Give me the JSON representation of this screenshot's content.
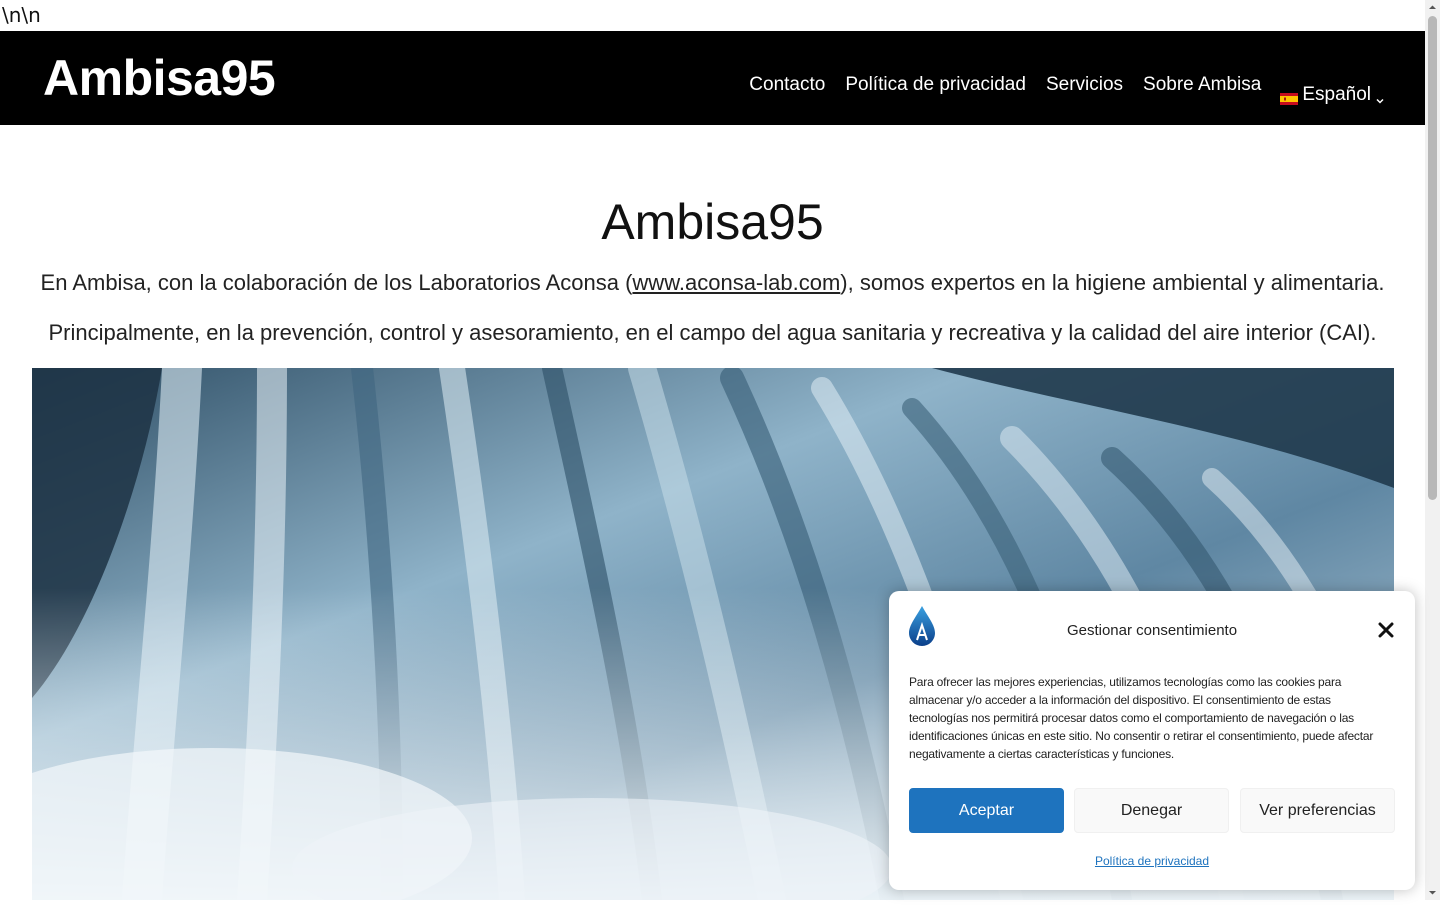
{
  "stray_text": "\\n\\n",
  "header": {
    "site_title": "Ambisa95",
    "nav": [
      {
        "label": "Contacto"
      },
      {
        "label": "Política de privacidad"
      },
      {
        "label": "Servicios"
      },
      {
        "label": "Sobre Ambisa"
      }
    ],
    "language": {
      "label": "Español",
      "flag_icon": "spain-flag-icon"
    }
  },
  "main": {
    "heading": "Ambisa95",
    "intro_1_before": "En Ambisa, con la colaboración de los Laboratorios Aconsa (",
    "intro_1_link": "www.aconsa-lab.com",
    "intro_1_after": "), somos expertos en la higiene ambiental y alimentaria.",
    "intro_2": "Principalmente, en la prevención, control y asesoramiento, en el campo del agua sanitaria y recreativa y la calidad del aire interior (CAI).",
    "hero_image": "waterfall-photo"
  },
  "cookie_banner": {
    "logo_icon": "water-drop-logo-icon",
    "title": "Gestionar consentimiento",
    "message": "Para ofrecer las mejores experiencias, utilizamos tecnologías como las cookies para almacenar y/o acceder a la información del dispositivo. El consentimiento de estas tecnologías nos permitirá procesar datos como el comportamiento de navegación o las identificaciones únicas en este sitio. No consentir o retirar el consentimiento, puede afectar negativamente a ciertas características y funciones.",
    "accept_label": "Aceptar",
    "deny_label": "Denegar",
    "preferences_label": "Ver preferencias",
    "policy_link": "Política de privacidad"
  },
  "colors": {
    "header_bg": "#000000",
    "accent": "#1e73be"
  }
}
